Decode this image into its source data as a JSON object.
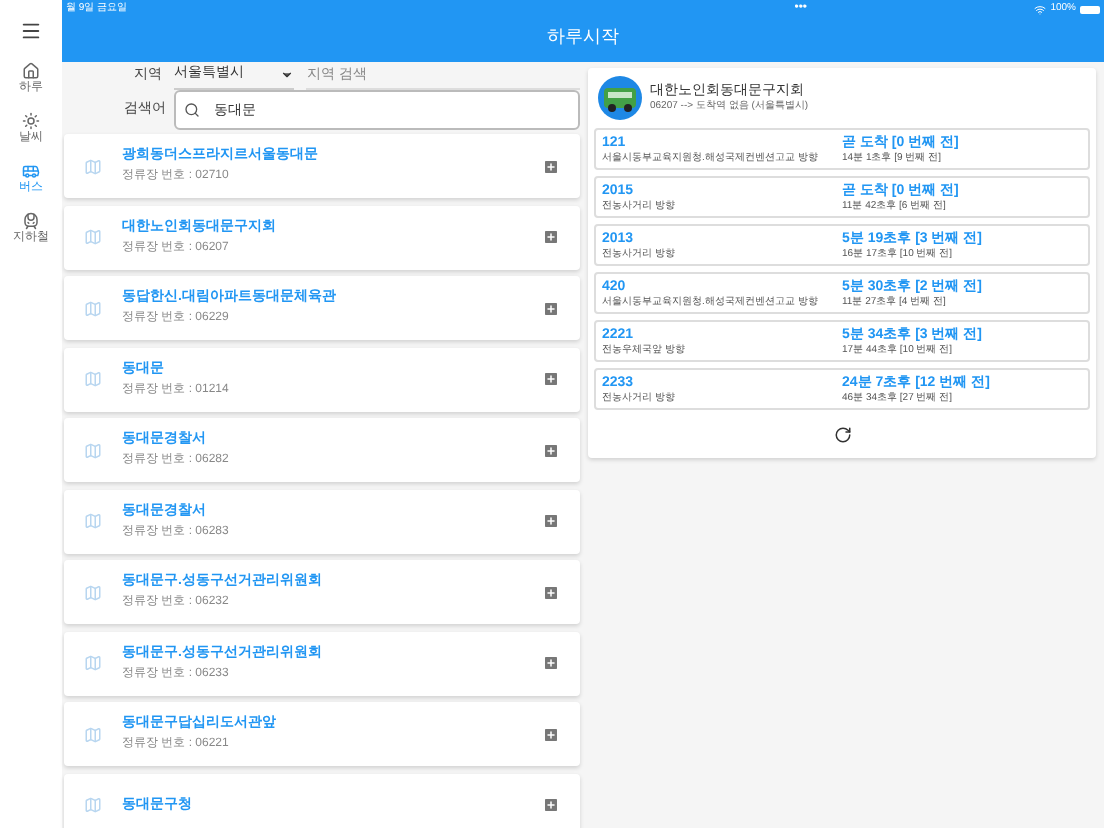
{
  "status_bar": {
    "date": "월 9일 금요일",
    "dots": "•••",
    "battery": "100%"
  },
  "app_bar": {
    "title": "하루시작"
  },
  "nav": [
    {
      "label": "하루",
      "selected": false
    },
    {
      "label": "날씨",
      "selected": false
    },
    {
      "label": "버스",
      "selected": true
    },
    {
      "label": "지하철",
      "selected": false
    }
  ],
  "search": {
    "region_label": "지역",
    "region_value": "서울특별시",
    "region_search_placeholder": "지역 검색",
    "keyword_label": "검색어",
    "keyword_value": "동대문"
  },
  "stops": [
    {
      "name": "광희동더스프라지르서울동대문",
      "number": "정류장 번호 : 02710"
    },
    {
      "name": "대한노인회동대문구지회",
      "number": "정류장 번호 : 06207"
    },
    {
      "name": "동답한신.대림아파트동대문체육관",
      "number": "정류장 번호 : 06229"
    },
    {
      "name": "동대문",
      "number": "정류장 번호 : 01214"
    },
    {
      "name": "동대문경찰서",
      "number": "정류장 번호 : 06282"
    },
    {
      "name": "동대문경찰서",
      "number": "정류장 번호 : 06283"
    },
    {
      "name": "동대문구.성동구선거관리위원회",
      "number": "정류장 번호 : 06232"
    },
    {
      "name": "동대문구.성동구선거관리위원회",
      "number": "정류장 번호 : 06233"
    },
    {
      "name": "동대문구답십리도서관앞",
      "number": "정류장 번호 : 06221"
    },
    {
      "name": "동대문구청"
    }
  ],
  "detail": {
    "stop_name": "대한노인회동대문구지회",
    "subtitle": "06207 --> 도착역 없음 (서울특별시)",
    "arrivals": [
      {
        "route": "121",
        "direction": "서울시동부교육지원청.해성국제컨벤션고교 방향",
        "first": "곧 도착 [0 번째 전]",
        "second": "14분 1초후 [9 번째 전]"
      },
      {
        "route": "2015",
        "direction": "전농사거리 방향",
        "first": "곧 도착 [0 번째 전]",
        "second": "11분 42초후 [6 번째 전]"
      },
      {
        "route": "2013",
        "direction": "전농사거리 방향",
        "first": "5분 19초후 [3 번째 전]",
        "second": "16분 17초후 [10 번째 전]"
      },
      {
        "route": "420",
        "direction": "서울시동부교육지원청.해성국제컨벤션고교 방향",
        "first": "5분 30초후 [2 번째 전]",
        "second": "11분 27초후 [4 번째 전]"
      },
      {
        "route": "2221",
        "direction": "전농우체국앞 방향",
        "first": "5분 34초후 [3 번째 전]",
        "second": "17분 44초후 [10 번째 전]"
      },
      {
        "route": "2233",
        "direction": "전농사거리 방향",
        "first": "24분 7초후 [12 번째 전]",
        "second": "46분 34초후 [27 번째 전]"
      }
    ]
  }
}
